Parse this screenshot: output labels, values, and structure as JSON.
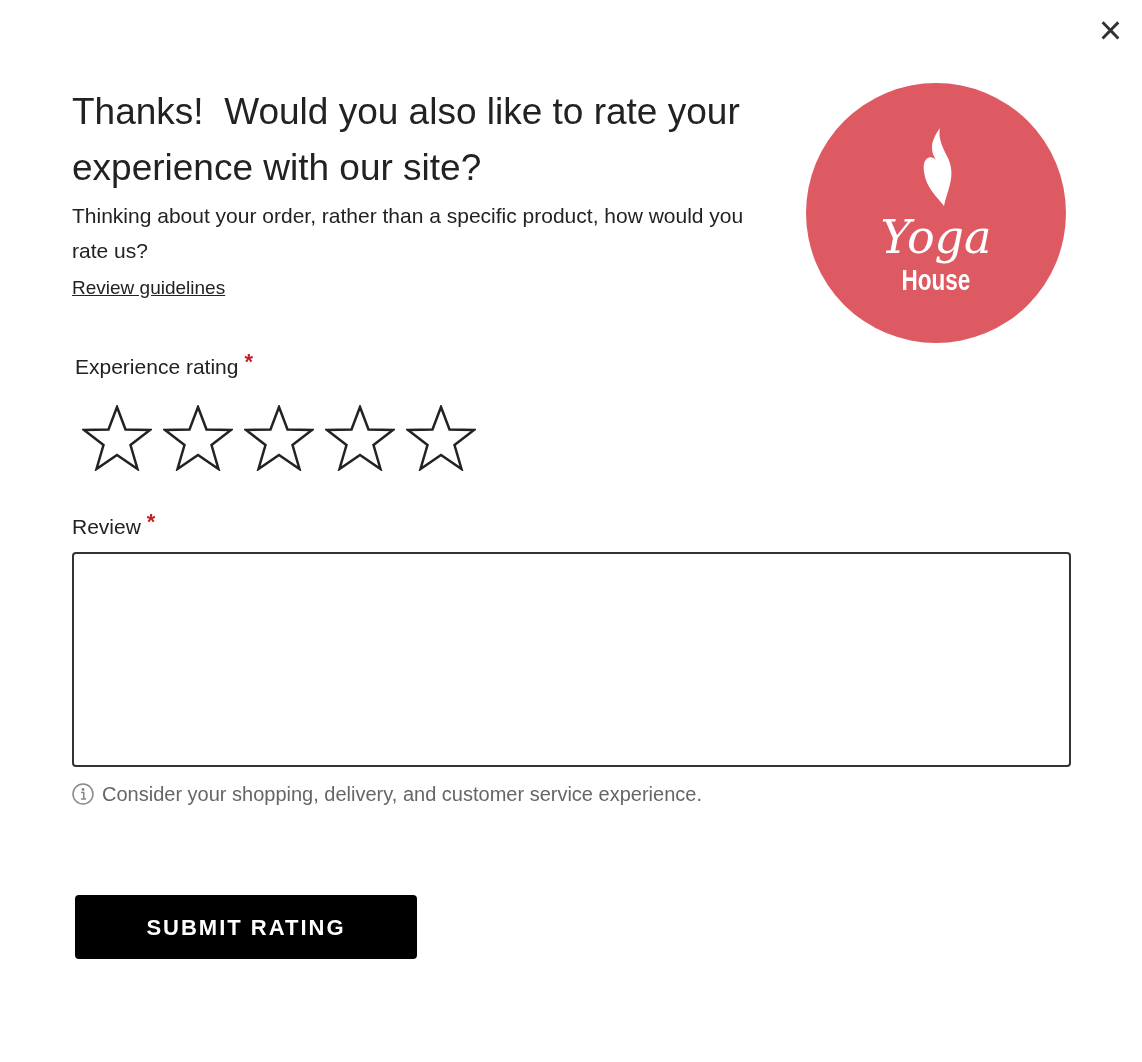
{
  "close": {
    "label": "×"
  },
  "heading": "Thanks!  Would you also like to rate your experience with our site?",
  "intro": "Thinking about your order, rather than a specific product, how would you rate us?",
  "guidelines_link": "Review guidelines",
  "logo": {
    "name": "Yoga",
    "subname": "House"
  },
  "rating": {
    "label": "Experience rating",
    "required_mark": "*",
    "stars": 0
  },
  "review": {
    "label": "Review",
    "required_mark": "*",
    "hint": "Consider your shopping, delivery, and customer service experience."
  },
  "submit": "SUBMIT RATING"
}
